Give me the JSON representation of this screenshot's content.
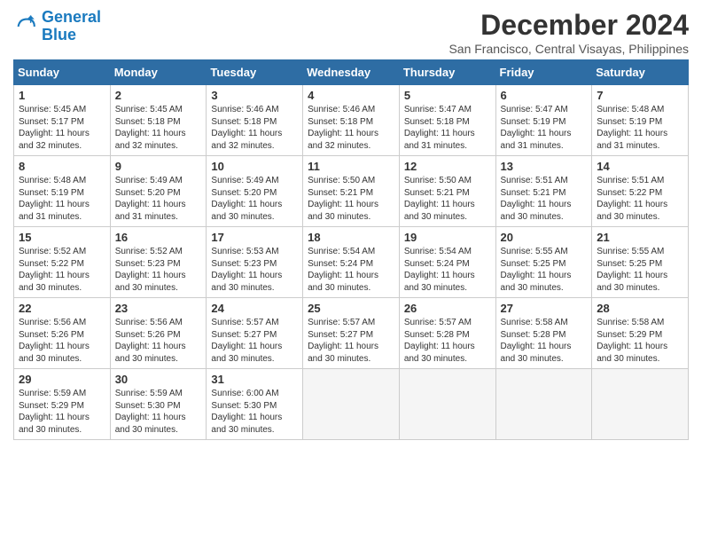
{
  "logo": {
    "line1": "General",
    "line2": "Blue"
  },
  "title": "December 2024",
  "subtitle": "San Francisco, Central Visayas, Philippines",
  "weekdays": [
    "Sunday",
    "Monday",
    "Tuesday",
    "Wednesday",
    "Thursday",
    "Friday",
    "Saturday"
  ],
  "weeks": [
    [
      {
        "day": "1",
        "sunrise": "5:45 AM",
        "sunset": "5:17 PM",
        "daylight": "11 hours and 32 minutes."
      },
      {
        "day": "2",
        "sunrise": "5:45 AM",
        "sunset": "5:18 PM",
        "daylight": "11 hours and 32 minutes."
      },
      {
        "day": "3",
        "sunrise": "5:46 AM",
        "sunset": "5:18 PM",
        "daylight": "11 hours and 32 minutes."
      },
      {
        "day": "4",
        "sunrise": "5:46 AM",
        "sunset": "5:18 PM",
        "daylight": "11 hours and 32 minutes."
      },
      {
        "day": "5",
        "sunrise": "5:47 AM",
        "sunset": "5:18 PM",
        "daylight": "11 hours and 31 minutes."
      },
      {
        "day": "6",
        "sunrise": "5:47 AM",
        "sunset": "5:19 PM",
        "daylight": "11 hours and 31 minutes."
      },
      {
        "day": "7",
        "sunrise": "5:48 AM",
        "sunset": "5:19 PM",
        "daylight": "11 hours and 31 minutes."
      }
    ],
    [
      {
        "day": "8",
        "sunrise": "5:48 AM",
        "sunset": "5:19 PM",
        "daylight": "11 hours and 31 minutes."
      },
      {
        "day": "9",
        "sunrise": "5:49 AM",
        "sunset": "5:20 PM",
        "daylight": "11 hours and 31 minutes."
      },
      {
        "day": "10",
        "sunrise": "5:49 AM",
        "sunset": "5:20 PM",
        "daylight": "11 hours and 30 minutes."
      },
      {
        "day": "11",
        "sunrise": "5:50 AM",
        "sunset": "5:21 PM",
        "daylight": "11 hours and 30 minutes."
      },
      {
        "day": "12",
        "sunrise": "5:50 AM",
        "sunset": "5:21 PM",
        "daylight": "11 hours and 30 minutes."
      },
      {
        "day": "13",
        "sunrise": "5:51 AM",
        "sunset": "5:21 PM",
        "daylight": "11 hours and 30 minutes."
      },
      {
        "day": "14",
        "sunrise": "5:51 AM",
        "sunset": "5:22 PM",
        "daylight": "11 hours and 30 minutes."
      }
    ],
    [
      {
        "day": "15",
        "sunrise": "5:52 AM",
        "sunset": "5:22 PM",
        "daylight": "11 hours and 30 minutes."
      },
      {
        "day": "16",
        "sunrise": "5:52 AM",
        "sunset": "5:23 PM",
        "daylight": "11 hours and 30 minutes."
      },
      {
        "day": "17",
        "sunrise": "5:53 AM",
        "sunset": "5:23 PM",
        "daylight": "11 hours and 30 minutes."
      },
      {
        "day": "18",
        "sunrise": "5:54 AM",
        "sunset": "5:24 PM",
        "daylight": "11 hours and 30 minutes."
      },
      {
        "day": "19",
        "sunrise": "5:54 AM",
        "sunset": "5:24 PM",
        "daylight": "11 hours and 30 minutes."
      },
      {
        "day": "20",
        "sunrise": "5:55 AM",
        "sunset": "5:25 PM",
        "daylight": "11 hours and 30 minutes."
      },
      {
        "day": "21",
        "sunrise": "5:55 AM",
        "sunset": "5:25 PM",
        "daylight": "11 hours and 30 minutes."
      }
    ],
    [
      {
        "day": "22",
        "sunrise": "5:56 AM",
        "sunset": "5:26 PM",
        "daylight": "11 hours and 30 minutes."
      },
      {
        "day": "23",
        "sunrise": "5:56 AM",
        "sunset": "5:26 PM",
        "daylight": "11 hours and 30 minutes."
      },
      {
        "day": "24",
        "sunrise": "5:57 AM",
        "sunset": "5:27 PM",
        "daylight": "11 hours and 30 minutes."
      },
      {
        "day": "25",
        "sunrise": "5:57 AM",
        "sunset": "5:27 PM",
        "daylight": "11 hours and 30 minutes."
      },
      {
        "day": "26",
        "sunrise": "5:57 AM",
        "sunset": "5:28 PM",
        "daylight": "11 hours and 30 minutes."
      },
      {
        "day": "27",
        "sunrise": "5:58 AM",
        "sunset": "5:28 PM",
        "daylight": "11 hours and 30 minutes."
      },
      {
        "day": "28",
        "sunrise": "5:58 AM",
        "sunset": "5:29 PM",
        "daylight": "11 hours and 30 minutes."
      }
    ],
    [
      {
        "day": "29",
        "sunrise": "5:59 AM",
        "sunset": "5:29 PM",
        "daylight": "11 hours and 30 minutes."
      },
      {
        "day": "30",
        "sunrise": "5:59 AM",
        "sunset": "5:30 PM",
        "daylight": "11 hours and 30 minutes."
      },
      {
        "day": "31",
        "sunrise": "6:00 AM",
        "sunset": "5:30 PM",
        "daylight": "11 hours and 30 minutes."
      },
      null,
      null,
      null,
      null
    ]
  ]
}
